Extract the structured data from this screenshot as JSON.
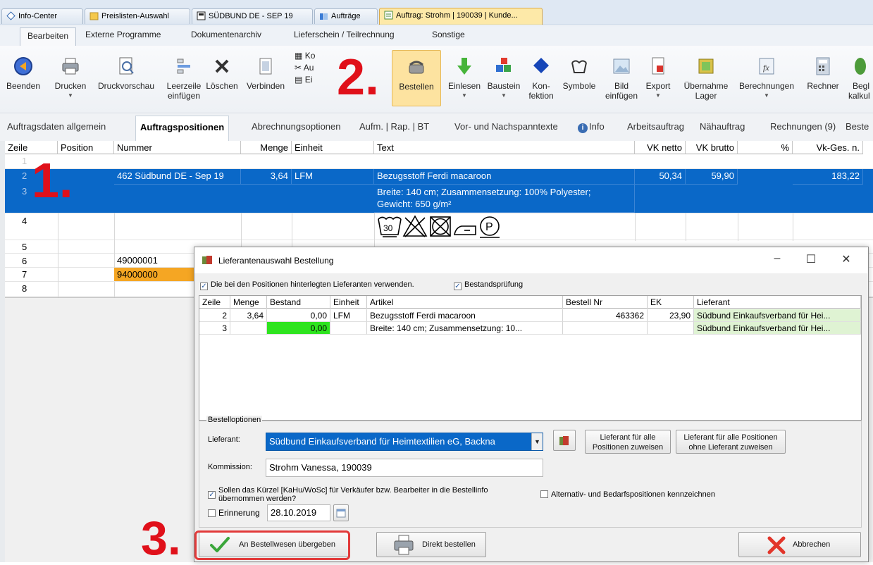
{
  "doc_tabs": [
    {
      "label": "Info-Center"
    },
    {
      "label": "Preislisten-Auswahl"
    },
    {
      "label": "SÜDBUND DE - SEP 19"
    },
    {
      "label": "Aufträge"
    },
    {
      "label": "Auftrag: Strohm | 190039 | Kunde..."
    }
  ],
  "ribbon_tabs": [
    {
      "label": "Bearbeiten"
    },
    {
      "label": "Externe Programme"
    },
    {
      "label": "Dokumentenarchiv"
    },
    {
      "label": "Lieferschein / Teilrechnung"
    },
    {
      "label": "Sonstige"
    }
  ],
  "ribbon_buttons": {
    "beenden": "Beenden",
    "drucken": "Drucken",
    "druckvorschau": "Druckvorschau",
    "leerzeile_1": "Leerzeile",
    "leerzeile_2": "einfügen",
    "loeschen": "Löschen",
    "verbinden": "Verbinden",
    "ko": "Ko",
    "au": "Au",
    "ei": "Ei",
    "bestellen": "Bestellen",
    "einlesen": "Einlesen",
    "baustein": "Baustein",
    "konfektion_1": "Kon-",
    "konfektion_2": "fektion",
    "symbole": "Symbole",
    "bild_1": "Bild",
    "bild_2": "einfügen",
    "export": "Export",
    "uebernahme_1": "Übernahme",
    "uebernahme_2": "Lager",
    "berechnungen": "Berechnungen",
    "rechner": "Rechner",
    "begl_1": "Begl",
    "begl_2": "kalkul"
  },
  "subnav": [
    {
      "label": "Auftragsdaten allgemein"
    },
    {
      "label": "Auftragspositionen"
    },
    {
      "label": "Abrechnungsoptionen"
    },
    {
      "label": "Aufm. | Rap. | BT"
    },
    {
      "label": "Vor- und Nachspanntexte"
    },
    {
      "label": "Info"
    },
    {
      "label": "Arbeitsauftrag"
    },
    {
      "label": "Nähauftrag"
    },
    {
      "label": "Rechnungen (9)"
    },
    {
      "label": "Beste"
    }
  ],
  "grid": {
    "headers": [
      "Zeile",
      "Position",
      "Nummer",
      "Menge",
      "Einheit",
      "Text",
      "VK netto",
      "VK brutto",
      "%",
      "Vk-Ges. n."
    ],
    "row_numbers": [
      "1",
      "2",
      "3",
      "4",
      "5",
      "6",
      "7",
      "8"
    ],
    "row2": {
      "nummer": "462 Südbund DE - Sep 19",
      "menge": "3,64",
      "einheit": "LFM",
      "text": "Bezugsstoff Ferdi macaroon",
      "vk_netto": "50,34",
      "vk_brutto": "59,90",
      "vk_ges": "183,22"
    },
    "row3": {
      "text_line1": "Breite: 140 cm; Zusammensetzung: 100% Polyester;",
      "text_line2": "Gewicht: 650 g/m²"
    },
    "row6": {
      "nummer": "49000001"
    },
    "row7": {
      "nummer": "94000000"
    },
    "care_symbols": [
      "30",
      "P"
    ]
  },
  "annotations": {
    "one": "1",
    "two": "2",
    "three": "3"
  },
  "dialog": {
    "title": "Lieferantenauswahl Bestellung",
    "check_use_suppliers": "Die bei den Positionen hinterlegten Lieferanten verwenden.",
    "check_bestand": "Bestandsprüfung",
    "grid_headers": [
      "Zeile",
      "Menge",
      "Bestand",
      "Einheit",
      "Artikel",
      "Bestell Nr",
      "EK",
      "Lieferant"
    ],
    "rows": [
      {
        "zeile": "2",
        "menge": "3,64",
        "bestand": "0,00",
        "einheit": "LFM",
        "artikel": "Bezugsstoff Ferdi macaroon",
        "bestell_nr": "463362",
        "ek": "23,90",
        "lieferant": "Südbund Einkaufsverband für Hei..."
      },
      {
        "zeile": "3",
        "menge": "",
        "bestand": "0,00",
        "einheit": "",
        "artikel": "Breite: 140 cm; Zusammensetzung: 10...",
        "bestell_nr": "",
        "ek": "",
        "lieferant": "Südbund Einkaufsverband für Hei..."
      }
    ],
    "options_legend": "Bestelloptionen",
    "lieferant_label": "Lieferant:",
    "lieferant_value": "Südbund Einkaufsverband für Heimtextilien eG, Backna",
    "btn_assign_all_1": "Lieferant für alle",
    "btn_assign_all_2": "Positionen zuweisen",
    "btn_assign_missing_1": "Lieferant für alle Positionen",
    "btn_assign_missing_2": "ohne Lieferant zuweisen",
    "kommission_label": "Kommission:",
    "kommission_value": "Strohm Vanessa, 190039",
    "check_kuerzel_1": "Sollen das Kürzel [KaHu/WoSc] für Verkäufer bzw. Bearbeiter in die Bestellinfo",
    "check_kuerzel_2": "übernommen werden?",
    "check_alternativ": "Alternativ- und Bedarfspositionen kennzeichnen",
    "erinnerung_label": "Erinnerung",
    "erinnerung_date": "28.10.2019",
    "btn_uebergeben": "An Bestellwesen übergeben",
    "btn_direkt": "Direkt bestellen",
    "btn_abbrechen": "Abbrechen"
  },
  "colors": {
    "selection": "#0a68c8",
    "stock_green": "#2ee41f",
    "supplier_green": "#dff3d3",
    "annotation_red": "#e0101a"
  }
}
